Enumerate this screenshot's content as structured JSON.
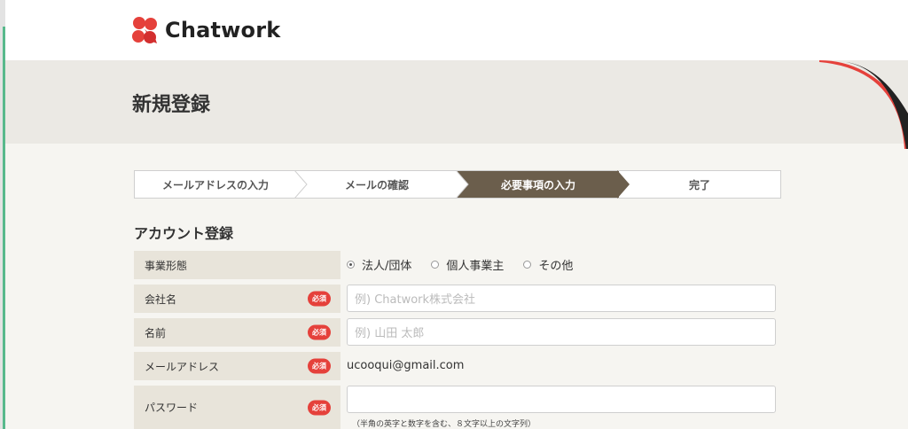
{
  "brand": {
    "name": "Chatwork",
    "colors": {
      "red": "#e5413b",
      "dark": "#222222",
      "step_active": "#6b5e4c"
    }
  },
  "page": {
    "title": "新規登録"
  },
  "steps": [
    {
      "label": "メールアドレスの入力",
      "state": "done"
    },
    {
      "label": "メールの確認",
      "state": "done"
    },
    {
      "label": "必要事項の入力",
      "state": "active"
    },
    {
      "label": "完了",
      "state": "pending"
    }
  ],
  "section": {
    "title": "アカウント登録"
  },
  "form": {
    "business_type": {
      "label": "事業形態",
      "options": [
        "法人/団体",
        "個人事業主",
        "その他"
      ],
      "selected": "法人/団体"
    },
    "company": {
      "label": "会社名",
      "required": "必須",
      "placeholder": "例) Chatwork株式会社",
      "value": ""
    },
    "name": {
      "label": "名前",
      "required": "必須",
      "placeholder": "例) 山田 太郎",
      "value": ""
    },
    "email": {
      "label": "メールアドレス",
      "required": "必須",
      "value": "ucooqui@gmail.com"
    },
    "password": {
      "label": "パスワード",
      "required": "必須",
      "value": "",
      "hint": "（半角の英字と数字を含む、８文字以上の文字列）"
    }
  }
}
